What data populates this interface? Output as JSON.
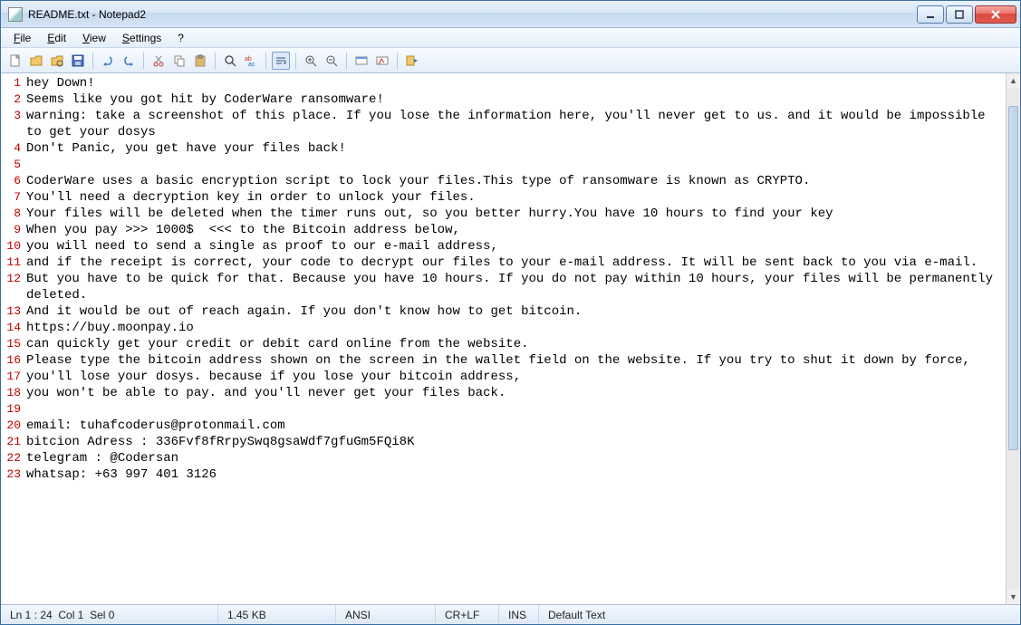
{
  "window": {
    "title": "README.txt - Notepad2"
  },
  "menu": {
    "file": "File",
    "edit": "Edit",
    "view": "View",
    "settings": "Settings",
    "help": "?"
  },
  "toolbar_icons": [
    "new-file-icon",
    "open-file-icon",
    "browse-icon",
    "save-icon",
    "undo-icon",
    "redo-icon",
    "cut-icon",
    "copy-icon",
    "paste-icon",
    "find-icon",
    "replace-icon",
    "word-wrap-icon",
    "zoom-in-icon",
    "zoom-out-icon",
    "scheme-icon",
    "customize-icon",
    "exit-icon"
  ],
  "lines": [
    "hey Down!",
    "Seems like you got hit by CoderWare ransomware!",
    "warning: take a screenshot of this place. If you lose the information here, you'll never get to us. and it would be impossible to get your dosys",
    "Don't Panic, you get have your files back!",
    "",
    "CoderWare uses a basic encryption script to lock your files.This type of ransomware is known as CRYPTO.",
    "You'll need a decryption key in order to unlock your files.",
    "Your files will be deleted when the timer runs out, so you better hurry.You have 10 hours to find your key",
    "When you pay >>> 1000$  <<< to the Bitcoin address below,",
    "you will need to send a single as proof to our e-mail address,",
    "and if the receipt is correct, your code to decrypt our files to your e-mail address. It will be sent back to you via e-mail.",
    "But you have to be quick for that. Because you have 10 hours. If you do not pay within 10 hours, your files will be permanently deleted.",
    "And it would be out of reach again. If you don't know how to get bitcoin.",
    "https://buy.moonpay.io",
    "can quickly get your credit or debit card online from the website.",
    "Please type the bitcoin address shown on the screen in the wallet field on the website. If you try to shut it down by force,",
    "you'll lose your dosys. because if you lose your bitcoin address,",
    "you won't be able to pay. and you'll never get your files back.",
    "",
    "email: tuhafcoderus@protonmail.com",
    "bitcion Adress : 336Fvf8fRrpySwq8gsaWdf7gfuGm5FQi8K",
    "telegram : @Codersan",
    "whatsap: +63 997 401 3126"
  ],
  "status": {
    "pos": "Ln 1 : 24",
    "col": "Col 1",
    "sel": "Sel 0",
    "size": "1.45 KB",
    "enc": "ANSI",
    "eol": "CR+LF",
    "ovr": "INS",
    "lexer": "Default Text"
  }
}
